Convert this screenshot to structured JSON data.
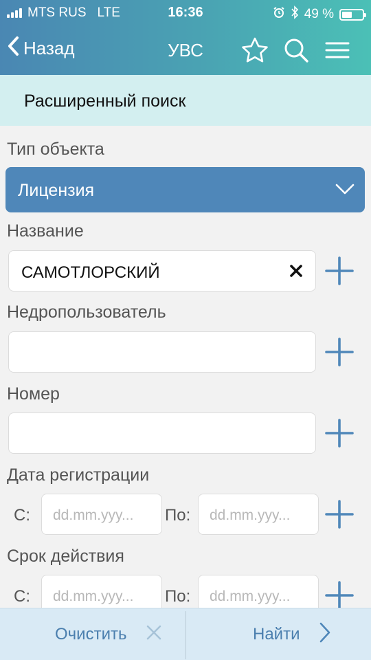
{
  "status_bar": {
    "carrier": "MTS RUS",
    "network": "LTE",
    "time": "16:36",
    "battery_percent": "49 %",
    "battery_level": 0.49
  },
  "nav": {
    "back_label": "Назад",
    "title": "УВС",
    "icons": [
      "star-icon",
      "search-icon",
      "menu-icon"
    ]
  },
  "subheader": {
    "title": "Расширенный поиск"
  },
  "form": {
    "object_type": {
      "label": "Тип объекта",
      "value": "Лицензия"
    },
    "name": {
      "label": "Название",
      "value": "САМОТЛОРСКИЙ"
    },
    "subsoil_user": {
      "label": "Недропользователь",
      "value": ""
    },
    "number": {
      "label": "Номер",
      "value": ""
    },
    "registration_date": {
      "label": "Дата регистрации",
      "from_label": "С:",
      "to_label": "По:",
      "from_placeholder": "dd.mm.yyy...",
      "to_placeholder": "dd.mm.yyy..."
    },
    "validity": {
      "label": "Срок действия",
      "from_label": "С:",
      "to_label": "По:",
      "from_placeholder": "dd.mm.yyy...",
      "to_placeholder": "dd.mm.yyy..."
    }
  },
  "footer": {
    "clear_label": "Очистить",
    "find_label": "Найти"
  },
  "colors": {
    "accent": "#4f87b9",
    "header_start": "#4a87b3",
    "header_end": "#4bc0b6",
    "subheader_bg": "#d3eff0",
    "footer_bg": "#d9eaf5"
  }
}
